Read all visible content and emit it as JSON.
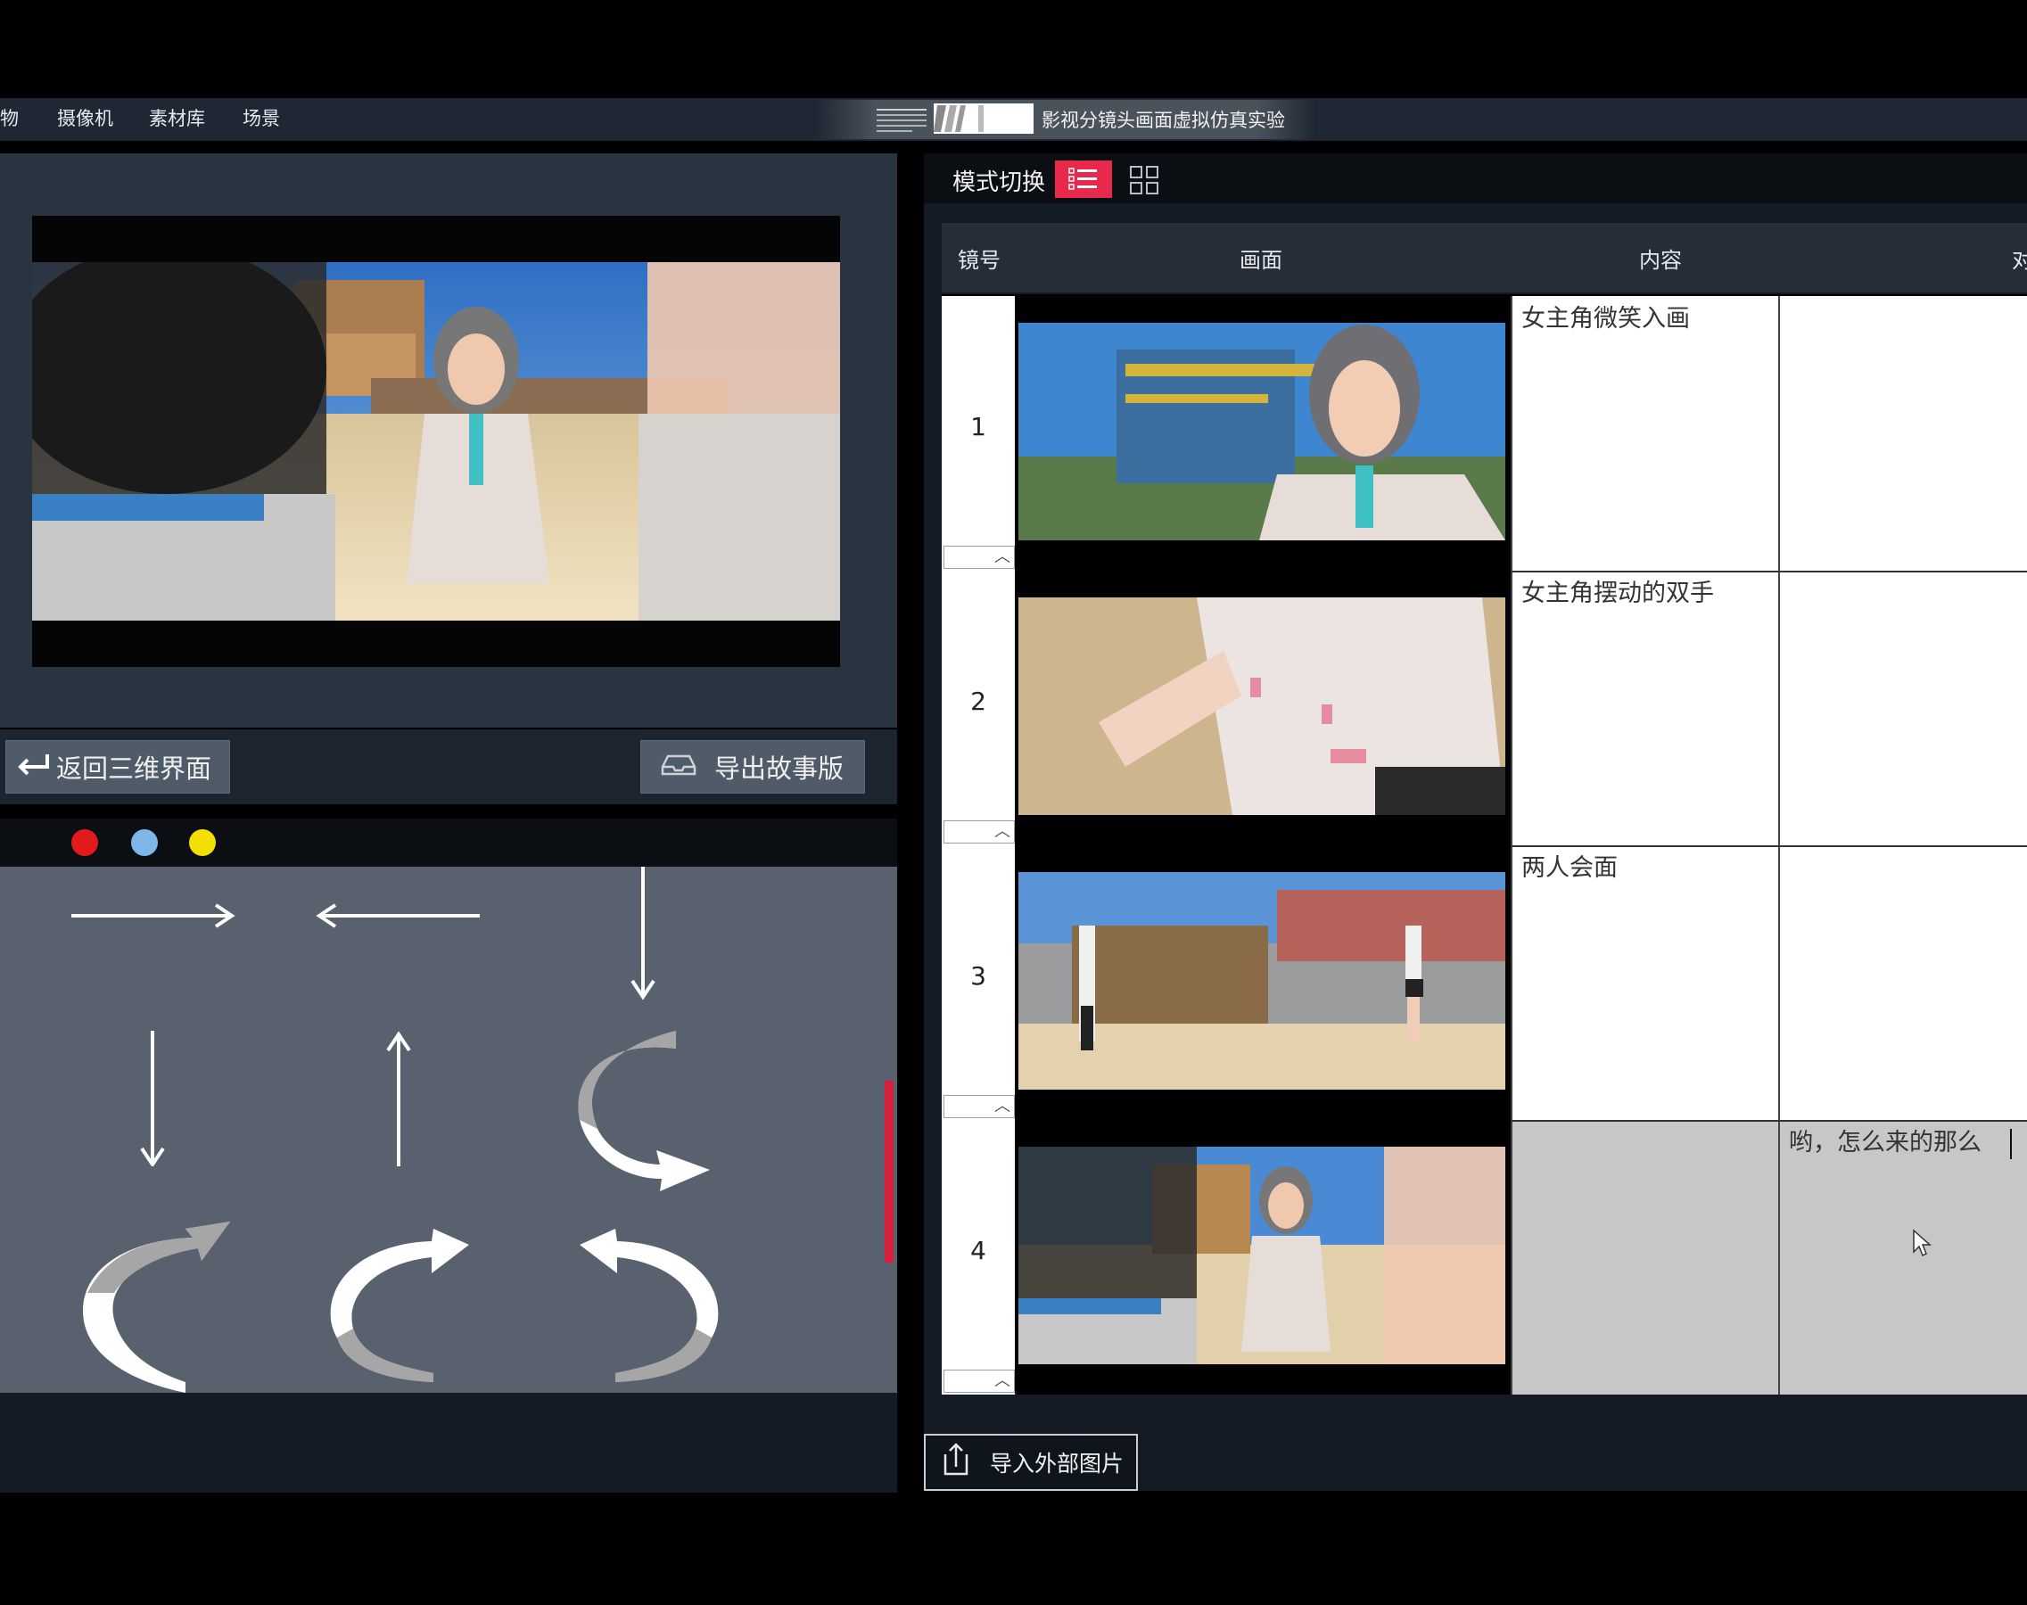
{
  "menu": {
    "items": [
      {
        "label": "物"
      },
      {
        "label": "摄像机"
      },
      {
        "label": "素材库"
      },
      {
        "label": "场景"
      }
    ],
    "title": "影视分镜头画面虚拟仿真实验"
  },
  "left": {
    "back_button": "返回三维界面",
    "export_button": "导出故事版",
    "palette": [
      {
        "name": "red",
        "color": "#e11b1b"
      },
      {
        "name": "blue",
        "color": "#7fb6ea"
      },
      {
        "name": "yellow",
        "color": "#f3e000"
      }
    ]
  },
  "right": {
    "mode_label": "模式切换",
    "headers": {
      "shot_no": "镜号",
      "frame": "画面",
      "content": "内容",
      "dialogue": "对"
    },
    "rows": [
      {
        "no": "1",
        "content": "女主角微笑入画",
        "dialogue": ""
      },
      {
        "no": "2",
        "content": "女主角摆动的双手",
        "dialogue": ""
      },
      {
        "no": "3",
        "content": "两人会面",
        "dialogue": ""
      },
      {
        "no": "4",
        "content": "",
        "dialogue": "哟，怎么来的那么"
      }
    ],
    "import_button": "导入外部图片"
  },
  "colors": {
    "accent": "#e8294b",
    "panel": "#2a3440",
    "dark": "#141b24"
  }
}
